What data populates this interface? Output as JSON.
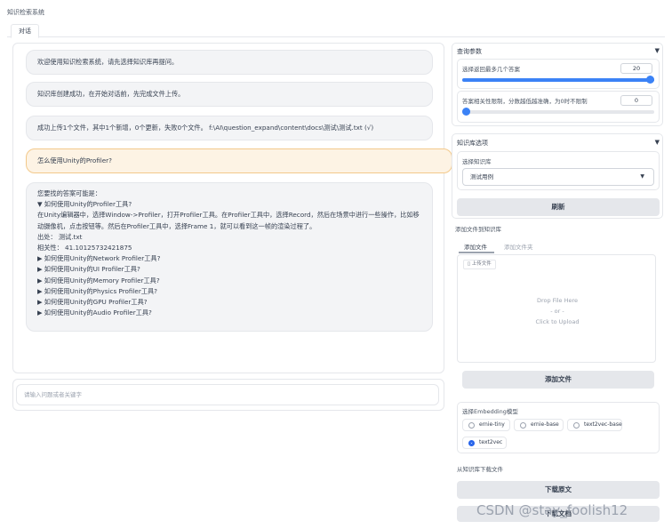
{
  "app": {
    "title": "知识检索系统"
  },
  "tabs": [
    {
      "label": "对话"
    }
  ],
  "chat": {
    "messages": [
      {
        "role": "bot",
        "text": "欢迎使用知识检索系统，请先选择知识库再提问。"
      },
      {
        "role": "bot",
        "text": "知识库创建成功，在开始对话前，先完成文件上传。"
      },
      {
        "role": "bot",
        "text": "成功上传1个文件，其中1个新增，0个更新，失败0个文件。 f:\\AI\\question_expand\\content\\docs\\测试\\测试.txt (√)"
      },
      {
        "role": "user",
        "text": "怎么使用Unity的Profiler?"
      }
    ],
    "answer": {
      "intro": "您要找的答案可能是：",
      "expanded_title": "▼ 如何使用Unity的Profiler工具?",
      "body": "在Unity编辑器中，选择Window->Profiler，打开Profiler工具。在Profiler工具中，选择Record，然后在场景中进行一些操作，比如移动摄像机，点击按钮等。然后在Profiler工具中，选择Frame 1，就可以看到这一帧的渲染过程了。",
      "source": "出处： 测试.txt",
      "relevance": "相关性： 41.10125732421875",
      "collapsed": [
        "▶ 如何使用Unity的Network Profiler工具?",
        "▶ 如何使用Unity的UI Profiler工具?",
        "▶ 如何使用Unity的Memory Profiler工具?",
        "▶ 如何使用Unity的Physics Profiler工具?",
        "▶ 如何使用Unity的GPU Profiler工具?",
        "▶ 如何使用Unity的Audio Profiler工具?"
      ]
    },
    "input": {
      "placeholder": "请输入问题或者关键字",
      "value": ""
    }
  },
  "query_params": {
    "header": "查询参数",
    "chevron": "▼",
    "top_k": {
      "label": "选择返回最多几个答案",
      "value": "20",
      "fraction": 1.0
    },
    "threshold": {
      "label": "答案相关性限制，分数越低越准确，为0时不限制",
      "value": "0",
      "fraction": 0.0
    }
  },
  "kb_options": {
    "header": "知识库选项",
    "chevron": "▼",
    "select_label": "选择知识库",
    "selected": "测试用例",
    "caret": "▼",
    "refresh_label": "刷新"
  },
  "add_files": {
    "title": "添加文件到知识库",
    "tabs": [
      "添加文件",
      "添加文件夹"
    ],
    "upload_label": "上传文件",
    "drop_text": "Drop File Here",
    "or_text": "- or -",
    "click_text": "Click to Upload",
    "add_button": "添加文件"
  },
  "embedding": {
    "label": "选择Embedding模型",
    "options": [
      "ernie-tiny",
      "ernie-base",
      "text2vec-base",
      "text2vec"
    ],
    "selected": "text2vec"
  },
  "download": {
    "title": "从知识库下载文件",
    "download_button": "下载原文",
    "second_button": "下载文档"
  },
  "watermark": "CSDN @stay_foolish12"
}
